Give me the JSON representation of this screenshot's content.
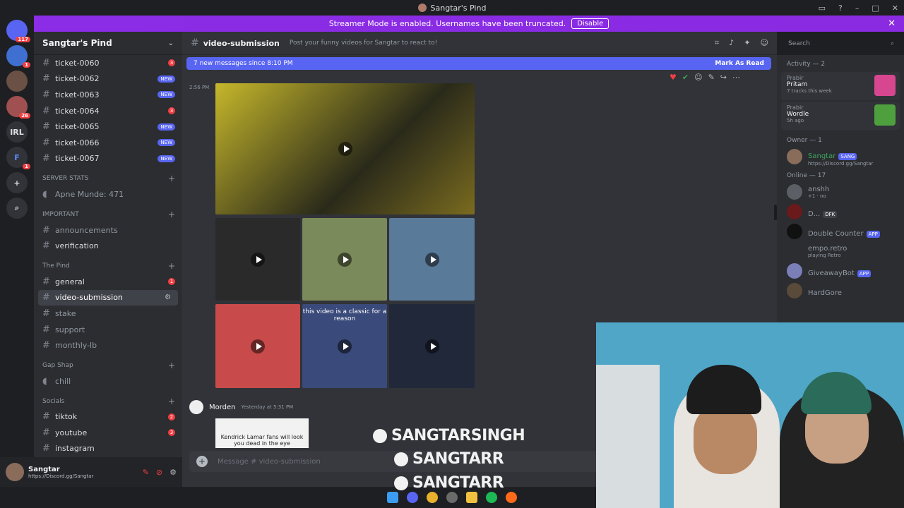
{
  "window": {
    "title": "Sangtar's Pind"
  },
  "banner": {
    "text": "Streamer Mode is enabled. Usernames have been truncated.",
    "button": "Disable"
  },
  "servers": [
    {
      "label": "",
      "badge": "117"
    },
    {
      "label": "",
      "badge": "1"
    },
    {
      "label": "",
      "badge": ""
    },
    {
      "label": "",
      "badge": "26"
    },
    {
      "label": "IRL",
      "badge": ""
    },
    {
      "label": "F",
      "badge": "1"
    },
    {
      "label": "+",
      "badge": ""
    },
    {
      "label": "⌕",
      "badge": ""
    }
  ],
  "guild": {
    "name": "Sangtar's Pind"
  },
  "channels": {
    "tickets": [
      {
        "name": "ticket-0060",
        "badge": "3"
      },
      {
        "name": "ticket-0062",
        "badge": "NEW"
      },
      {
        "name": "ticket-0063",
        "badge": "NEW"
      },
      {
        "name": "ticket-0064",
        "badge": "3"
      },
      {
        "name": "ticket-0065",
        "badge": "NEW"
      },
      {
        "name": "ticket-0066",
        "badge": "NEW"
      },
      {
        "name": "ticket-0067",
        "badge": "NEW"
      }
    ],
    "server_stats": {
      "category": "SERVER STATS",
      "item": "Apne Munde: 471"
    },
    "important": {
      "category": "IMPORTANT",
      "items": [
        "announcements",
        "verification"
      ]
    },
    "pind": {
      "category": "The Pind",
      "items": [
        {
          "name": "general",
          "badge": "1"
        },
        {
          "name": "video-submission",
          "badge": ""
        },
        {
          "name": "stake",
          "badge": ""
        },
        {
          "name": "support",
          "badge": ""
        },
        {
          "name": "monthly-lb",
          "badge": ""
        }
      ]
    },
    "gapshap": {
      "category": "Gap Shap",
      "item": "chill"
    },
    "socials": {
      "category": "Socials",
      "items": [
        {
          "name": "tiktok",
          "badge": "2"
        },
        {
          "name": "youtube",
          "badge": "3"
        },
        {
          "name": "instagram",
          "badge": ""
        }
      ]
    }
  },
  "user": {
    "name": "Sangtar",
    "status": "https://Discord.gg/Sangtar"
  },
  "channel_header": {
    "name": "video-submission",
    "topic": "Post your funny videos for Sangtar to react to!"
  },
  "new_messages": {
    "text": "7 new messages since 8:10 PM",
    "action": "Mark As Read"
  },
  "message": {
    "time": "2:56 PM"
  },
  "media_captions": {
    "m5": "this video is a classic for a reason"
  },
  "next_message": {
    "author": "Morden",
    "time": "Yesterday at 5:31 PM",
    "thumb_text": "Kendrick Lamar fans will look you dead in the eye"
  },
  "composer": {
    "placeholder": "Message # video-submission"
  },
  "search": {
    "placeholder": "Search"
  },
  "members": {
    "activity_title": "Activity — 2",
    "activities": [
      {
        "user": "Prabir",
        "title": "Pritam",
        "sub": "7 tracks this week",
        "color": "#d6478f"
      },
      {
        "user": "Prabir",
        "title": "Wordle",
        "sub": "5h ago",
        "color": "#4e9f3d"
      }
    ],
    "owner_title": "Owner — 1",
    "owner": {
      "name": "Sangtar",
      "tag": "SANG",
      "sub": "https://Discord.gg/Sangtar"
    },
    "online_title": "Online — 17",
    "online": [
      {
        "name": "anshh",
        "sub": "+1 · no",
        "tag": ""
      },
      {
        "name": "D...",
        "sub": "",
        "tag": "DFK"
      },
      {
        "name": "Double Counter",
        "sub": "",
        "tag": "APP"
      },
      {
        "name": "empo.retro",
        "sub": "playing Retro",
        "tag": ""
      },
      {
        "name": "GiveawayBot",
        "sub": "",
        "tag": "APP"
      },
      {
        "name": "HardGore",
        "sub": "",
        "tag": ""
      }
    ]
  },
  "overlay": {
    "line1": "SANGTARSINGH",
    "line2": "SANGTARR",
    "line3": "SANGTARR"
  }
}
